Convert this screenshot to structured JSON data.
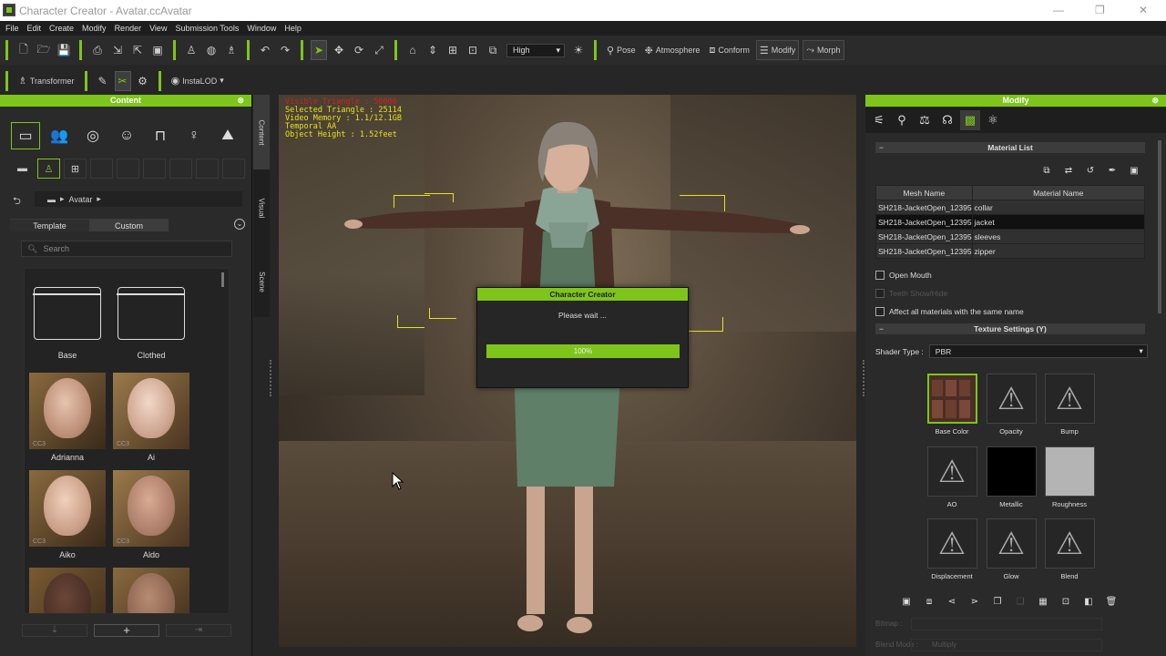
{
  "window": {
    "title": "Character Creator - Avatar.ccAvatar",
    "min": "—",
    "restore": "❐",
    "close": "✕"
  },
  "menu": [
    "File",
    "Edit",
    "Create",
    "Modify",
    "Render",
    "View",
    "Submission Tools",
    "Window",
    "Help"
  ],
  "toolbar": {
    "quality": "High",
    "pose_label": "Pose",
    "atmosphere_label": "Atmosphere",
    "conform_label": "Conform",
    "modify_label": "Modify",
    "morph_label": "Morph"
  },
  "toolbar2": {
    "transformer_label": "Transformer",
    "instalod_label": "InstaLOD"
  },
  "content": {
    "header": "Content",
    "breadcrumb": "Avatar",
    "tabs": [
      "Template",
      "Custom"
    ],
    "search_placeholder": "Search",
    "items": [
      {
        "label": "Base",
        "type": "folder"
      },
      {
        "label": "Clothed",
        "type": "folder"
      },
      {
        "label": "Adrianna",
        "type": "face",
        "tag": "CC3"
      },
      {
        "label": "Ai",
        "type": "face",
        "tag": "CC3"
      },
      {
        "label": "Aiko",
        "type": "face",
        "tag": "CC3"
      },
      {
        "label": "Aldo",
        "type": "face",
        "tag": "CC3"
      },
      {
        "label": "",
        "type": "face",
        "tag": ""
      },
      {
        "label": "",
        "type": "face",
        "tag": ""
      }
    ],
    "add_label": "+"
  },
  "side_tabs": [
    "Content",
    "Visual",
    "Scene"
  ],
  "viewport": {
    "stats": [
      {
        "text": "Visible Triangle : 50000",
        "red": true
      },
      {
        "text": "Selected Triangle : 25114",
        "red": false
      },
      {
        "text": "Video Memory : 1.1/12.1GB",
        "red": false
      },
      {
        "text": "Temporal AA",
        "red": false
      },
      {
        "text": "Object Height : 1.52feet",
        "red": false
      }
    ]
  },
  "dialog": {
    "title": "Character Creator",
    "message": "Please wait ...",
    "progress": 1.0,
    "progress_text": "100%"
  },
  "modify": {
    "header": "Modify",
    "material_list_title": "Material List",
    "columns": [
      "Mesh Name",
      "Material Name"
    ],
    "rows": [
      {
        "mesh": "SH218-JacketOpen_12395",
        "material": "collar",
        "selected": false
      },
      {
        "mesh": "SH218-JacketOpen_12395",
        "material": "jacket",
        "selected": true
      },
      {
        "mesh": "SH218-JacketOpen_12395",
        "material": "sleeves",
        "selected": false
      },
      {
        "mesh": "SH218-JacketOpen_12395",
        "material": "zipper",
        "selected": false
      }
    ],
    "open_mouth": "Open Mouth",
    "teeth": "Teeth Show/Hide",
    "affect_all": "Affect all materials with the same name",
    "texture_title": "Texture Settings  (Y)",
    "shader_label": "Shader Type :",
    "shader_value": "PBR",
    "textures": [
      "Base Color",
      "Opacity",
      "Bump",
      "AO",
      "Metallic",
      "Roughness",
      "Displacement",
      "Glow",
      "Blend"
    ],
    "bitmap_label": "Bitmap :",
    "blend_label": "Blend Mode :",
    "blend_value": "Multiply"
  },
  "colors": {
    "accent": "#7dc51a",
    "panel": "#2a2a2a",
    "selected_row": "#111111"
  }
}
